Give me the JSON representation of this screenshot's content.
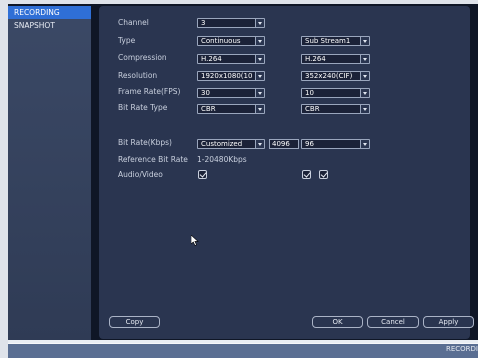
{
  "sidebar": {
    "items": [
      {
        "label": "RECORDING",
        "active": true
      },
      {
        "label": "SNAPSHOT",
        "active": false
      }
    ]
  },
  "form": {
    "channel": {
      "label": "Channel",
      "value": "3"
    },
    "type": {
      "label": "Type",
      "main_value": "Continuous",
      "sub_value": "Sub Stream1"
    },
    "compression": {
      "label": "Compression",
      "main_value": "H.264",
      "sub_value": "H.264"
    },
    "resolution": {
      "label": "Resolution",
      "main_value": "1920x1080(10",
      "sub_value": "352x240(CIF)"
    },
    "frame_rate": {
      "label": "Frame Rate(FPS)",
      "main_value": "30",
      "sub_value": "10"
    },
    "bit_rate_type": {
      "label": "Bit Rate Type",
      "main_value": "CBR",
      "sub_value": "CBR"
    },
    "bit_rate": {
      "label": "Bit Rate(Kbps)",
      "main_value": "Customized",
      "main_input": "4096",
      "sub_value": "96"
    },
    "reference_bit_rate": {
      "label": "Reference Bit Rate",
      "value": "1-20480Kbps"
    },
    "audio_video": {
      "label": "Audio/Video",
      "main_checked": true,
      "sub_audio_checked": true,
      "sub_video_checked": true
    }
  },
  "buttons": {
    "copy": "Copy",
    "ok": "OK",
    "cancel": "Cancel",
    "apply": "Apply"
  },
  "status_bar": {
    "text": "RECORDI"
  },
  "colors": {
    "active_tab": "#2f6fd6",
    "panel": "#2a3550",
    "frame": "#0f1626"
  }
}
